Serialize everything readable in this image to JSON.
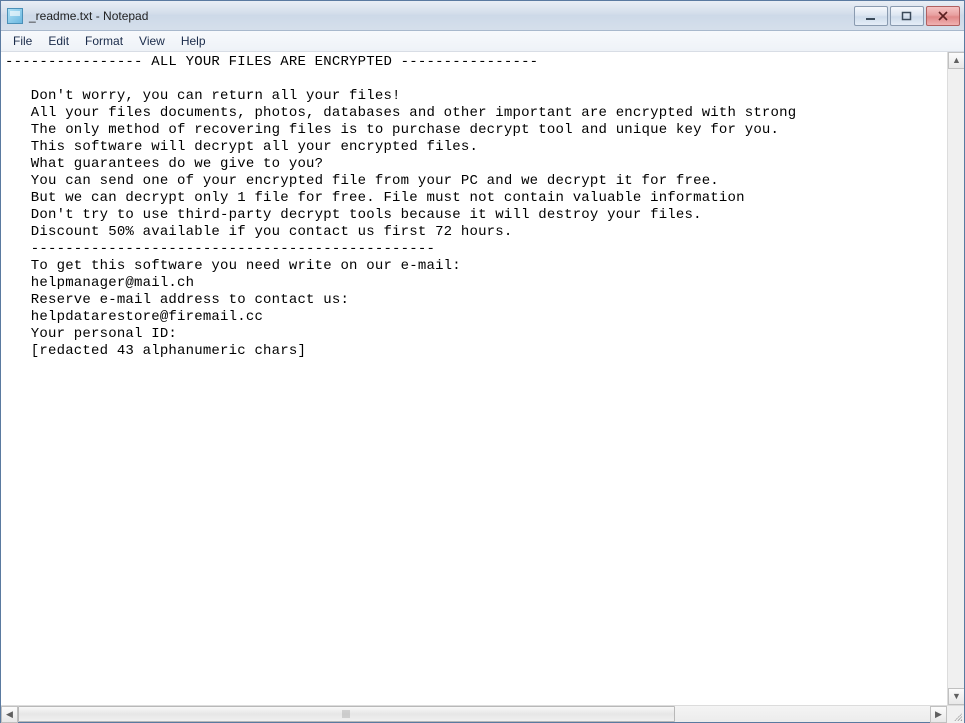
{
  "window": {
    "title": "_readme.txt - Notepad"
  },
  "menu": {
    "file": "File",
    "edit": "Edit",
    "format": "Format",
    "view": "View",
    "help": "Help"
  },
  "document": {
    "body": "---------------- ALL YOUR FILES ARE ENCRYPTED ----------------\n\n   Don't worry, you can return all your files!\n   All your files documents, photos, databases and other important are encrypted with strong\n   The only method of recovering files is to purchase decrypt tool and unique key for you.\n   This software will decrypt all your encrypted files.\n   What guarantees do we give to you?\n   You can send one of your encrypted file from your PC and we decrypt it for free.\n   But we can decrypt only 1 file for free. File must not contain valuable information\n   Don't try to use third-party decrypt tools because it will destroy your files.\n   Discount 50% available if you contact us first 72 hours.\n   -----------------------------------------------\n   To get this software you need write on our e-mail:\n   helpmanager@mail.ch\n   Reserve e-mail address to contact us:\n   helpdatarestore@firemail.cc\n   Your personal ID:\n   [redacted 43 alphanumeric chars]"
  }
}
